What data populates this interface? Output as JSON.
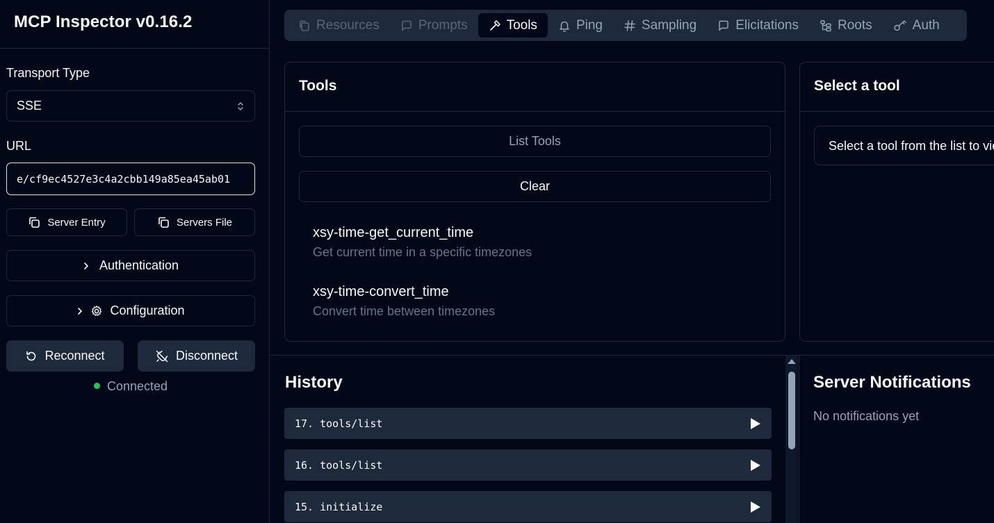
{
  "sidebar": {
    "title": "MCP Inspector v0.16.2",
    "transport_label": "Transport Type",
    "transport_value": "SSE",
    "url_label": "URL",
    "url_value": "e/cf9ec4527e3c4a2cbb149a85ea45ab01",
    "server_entry_label": "Server Entry",
    "servers_file_label": "Servers File",
    "authentication_label": "Authentication",
    "configuration_label": "Configuration",
    "reconnect_label": "Reconnect",
    "disconnect_label": "Disconnect",
    "status_text": "Connected",
    "status_color": "#22c55e"
  },
  "tabs": [
    {
      "label": "Resources",
      "icon": "files-icon",
      "state": "disabled"
    },
    {
      "label": "Prompts",
      "icon": "message-square-icon",
      "state": "disabled"
    },
    {
      "label": "Tools",
      "icon": "hammer-icon",
      "state": "active"
    },
    {
      "label": "Ping",
      "icon": "bell-icon",
      "state": "normal"
    },
    {
      "label": "Sampling",
      "icon": "hash-icon",
      "state": "normal"
    },
    {
      "label": "Elicitations",
      "icon": "message-square-icon",
      "state": "normal"
    },
    {
      "label": "Roots",
      "icon": "folder-tree-icon",
      "state": "normal"
    },
    {
      "label": "Auth",
      "icon": "key-icon",
      "state": "normal"
    }
  ],
  "tools_panel": {
    "title": "Tools",
    "list_tools_label": "List Tools",
    "clear_label": "Clear",
    "items": [
      {
        "name": "xsy-time-get_current_time",
        "description": "Get current time in a specific timezones"
      },
      {
        "name": "xsy-time-convert_time",
        "description": "Convert time between timezones"
      }
    ]
  },
  "select_panel": {
    "title": "Select a tool",
    "hint": "Select a tool from the list to view"
  },
  "history": {
    "title": "History",
    "items": [
      {
        "label": "17. tools/list"
      },
      {
        "label": "16. tools/list"
      },
      {
        "label": "15. initialize"
      }
    ]
  },
  "notifications": {
    "title": "Server Notifications",
    "empty_text": "No notifications yet"
  }
}
